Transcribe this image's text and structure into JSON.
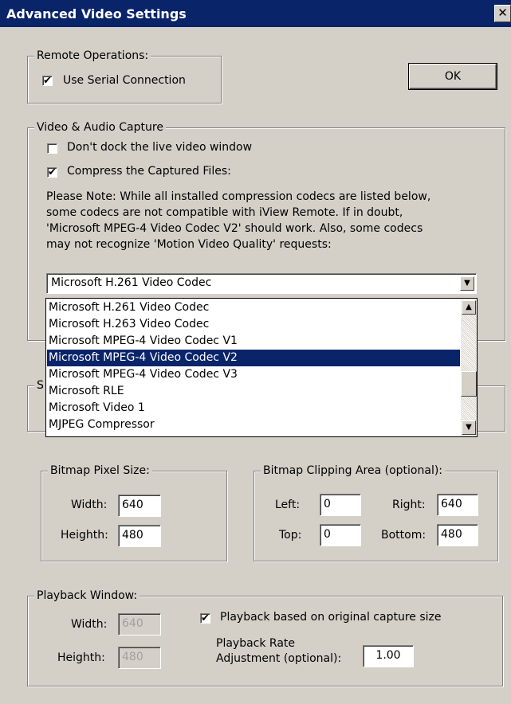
{
  "window": {
    "title": "Advanced Video Settings",
    "close_glyph": "✕"
  },
  "remote_ops": {
    "legend": "Remote Operations:",
    "use_serial_label": "Use Serial Connection",
    "use_serial_checked": true
  },
  "ok_button": "OK",
  "capture": {
    "legend": "Video & Audio Capture",
    "dont_dock_label": "Don't dock the live video window",
    "dont_dock_checked": false,
    "compress_label": "Compress the Captured Files:",
    "compress_checked": true,
    "note_lines": [
      "Please Note:  While all installed compression codecs are listed below,",
      "some codecs are not compatible with iView Remote.  If in doubt,",
      "'Microsoft MPEG-4 Video Codec V2' should work.  Also, some codecs",
      "may not recognize 'Motion Video Quality' requests:"
    ],
    "codec_selected": "Microsoft H.261 Video Codec",
    "codec_options": [
      "Microsoft H.261 Video Codec",
      "Microsoft H.263 Video Codec",
      "Microsoft MPEG-4 Video Codec V1",
      "Microsoft MPEG-4 Video Codec V2",
      "Microsoft MPEG-4 Video Codec V3",
      "Microsoft RLE",
      "Microsoft Video 1",
      "MJPEG Compressor"
    ],
    "highlighted_option": "Microsoft MPEG-4 Video Codec V2"
  },
  "hidden_group_legend_fragment": "S",
  "bitmap_size": {
    "legend": "Bitmap Pixel Size:",
    "width_label": "Width:",
    "width_value": "640",
    "height_label": "Heighth:",
    "height_value": "480"
  },
  "clipping": {
    "legend": "Bitmap Clipping Area (optional):",
    "left_label": "Left:",
    "left_value": "0",
    "right_label": "Right:",
    "right_value": "640",
    "top_label": "Top:",
    "top_value": "0",
    "bottom_label": "Bottom:",
    "bottom_value": "480"
  },
  "playback": {
    "legend": "Playback Window:",
    "width_label": "Width:",
    "width_value": "640",
    "height_label": "Heighth:",
    "height_value": "480",
    "original_size_label": "Playback based on original capture size",
    "original_size_checked": true,
    "rate_label_line1": "Playback Rate",
    "rate_label_line2": "Adjustment (optional):",
    "rate_value": "1.00"
  },
  "icons": {
    "check": "✔",
    "down_arrow": "▼",
    "up_arrow": "▲"
  }
}
